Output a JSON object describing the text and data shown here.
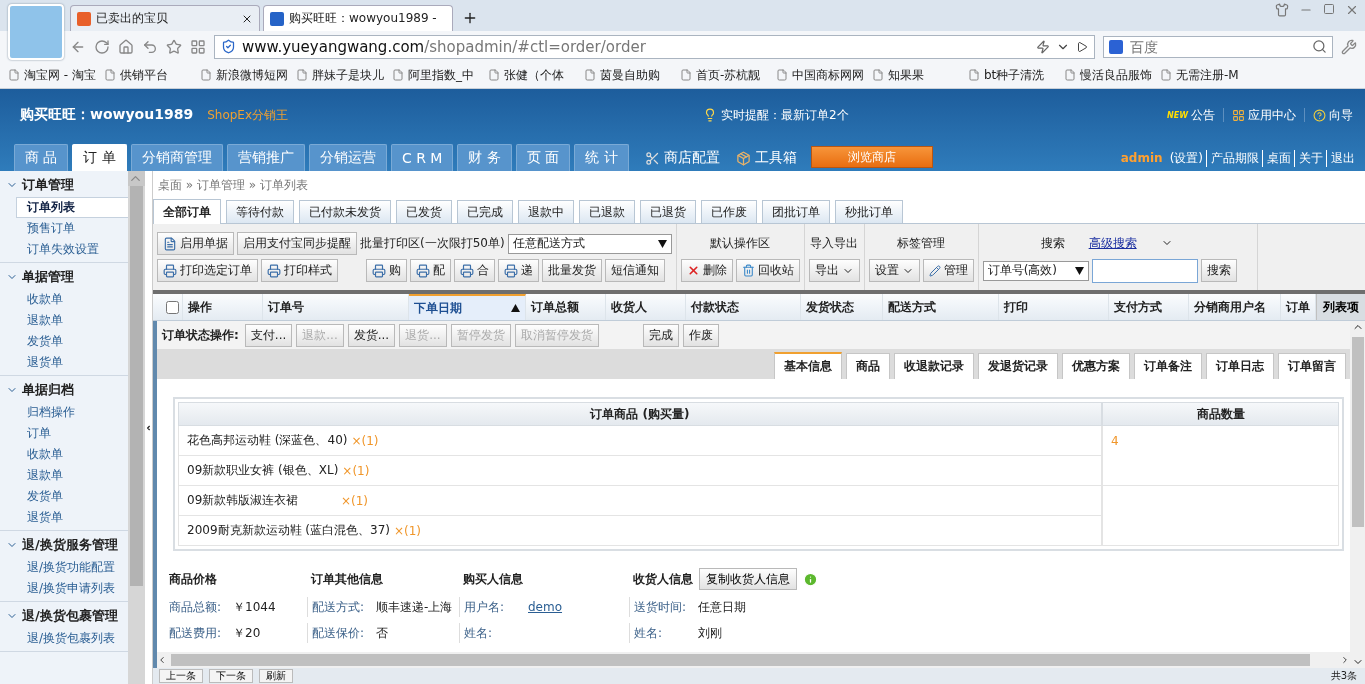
{
  "browser": {
    "tabs": [
      {
        "title": "已卖出的宝贝",
        "selected": false
      },
      {
        "title": "购买旺旺：wowyou1989 -",
        "selected": true
      }
    ],
    "url": {
      "host": "www.yueyangwang.com",
      "path": "/shopadmin/#ctl=order/order"
    },
    "search": {
      "placeholder": "百度"
    },
    "bookmarks": [
      "淘宝网 - 淘宝",
      "供销平台",
      "新浪微博短网",
      "胖妹子是块儿",
      "阿里指数_中",
      "张健（个体",
      "茵曼自助购",
      "首页-苏杭靓",
      "中国商标网网",
      "知果果",
      "bt种子清洗",
      "慢活良品服饰",
      "无需注册-M"
    ]
  },
  "header": {
    "title": "购买旺旺：wowyou1989",
    "brand": "ShopEx分销王",
    "notice": "实时提醒：最新订单2个",
    "new_badge": "NEW",
    "links": [
      "公告",
      "应用中心",
      "向导"
    ]
  },
  "nav": {
    "tabs": [
      {
        "label": "商 品",
        "selected": false
      },
      {
        "label": "订 单",
        "selected": true
      },
      {
        "label": "分销商管理",
        "selected": false
      },
      {
        "label": "营销推广",
        "selected": false
      },
      {
        "label": "分销运营",
        "selected": false
      },
      {
        "label": "C R M",
        "selected": false
      },
      {
        "label": "财 务",
        "selected": false
      },
      {
        "label": "页 面",
        "selected": false
      },
      {
        "label": "统 计",
        "selected": false
      }
    ],
    "tools": [
      "商店配置",
      "工具箱"
    ],
    "browse_button": "浏览商店",
    "user": "admin",
    "user_links": [
      "(设置)",
      "产品期限",
      "桌面",
      "关于",
      "退出"
    ]
  },
  "sidebar": [
    {
      "title": "订单管理",
      "expanded": true,
      "items": [
        {
          "label": "订单列表",
          "selected": true
        },
        {
          "label": "预售订单",
          "selected": false
        },
        {
          "label": "订单失效设置",
          "selected": false
        }
      ]
    },
    {
      "title": "单据管理",
      "expanded": true,
      "items": [
        {
          "label": "收款单",
          "selected": false
        },
        {
          "label": "退款单",
          "selected": false
        },
        {
          "label": "发货单",
          "selected": false
        },
        {
          "label": "退货单",
          "selected": false
        }
      ]
    },
    {
      "title": "单据归档",
      "expanded": true,
      "items": [
        {
          "label": "归档操作",
          "selected": false
        },
        {
          "label": "订单",
          "selected": false
        },
        {
          "label": "收款单",
          "selected": false
        },
        {
          "label": "退款单",
          "selected": false
        },
        {
          "label": "发货单",
          "selected": false
        },
        {
          "label": "退货单",
          "selected": false
        }
      ]
    },
    {
      "title": "退/换货服务管理",
      "expanded": true,
      "items": [
        {
          "label": "退/换货功能配置",
          "selected": false
        },
        {
          "label": "退/换货申请列表",
          "selected": false
        }
      ]
    },
    {
      "title": "退/换货包裹管理",
      "expanded": true,
      "items": [
        {
          "label": "退/换货包裹列表",
          "selected": false
        }
      ]
    }
  ],
  "breadcrumb": "桌面 » 订单管理 » 订单列表",
  "order_tabs": [
    {
      "label": "全部订单",
      "selected": true
    },
    {
      "label": "等待付款",
      "selected": false
    },
    {
      "label": "已付款未发货",
      "selected": false
    },
    {
      "label": "已发货",
      "selected": false
    },
    {
      "label": "已完成",
      "selected": false
    },
    {
      "label": "退款中",
      "selected": false
    },
    {
      "label": "已退款",
      "selected": false
    },
    {
      "label": "已退货",
      "selected": false
    },
    {
      "label": "已作废",
      "selected": false
    },
    {
      "label": "团批订单",
      "selected": false
    },
    {
      "label": "秒批订单",
      "selected": false
    }
  ],
  "toolbar": {
    "row1": [
      {
        "label": "启用单据"
      },
      {
        "label": "启用支付宝同步提醒"
      }
    ],
    "print_label": "批量打印区(一次限打50单)",
    "delivery_select": "任意配送方式",
    "row2": [
      {
        "label": "打印选定订单"
      },
      {
        "label": "打印样式"
      }
    ],
    "print_buttons": [
      {
        "label": "购"
      },
      {
        "label": "配"
      },
      {
        "label": "合"
      },
      {
        "label": "递"
      },
      {
        "label": "批量发货"
      },
      {
        "label": "短信通知"
      }
    ],
    "default_title": "默认操作区",
    "delete": "删除",
    "recycle": "回收站",
    "io_title": "导入导出",
    "export": "导出",
    "tag_title": "标签管理",
    "tag_set": "设置",
    "tag_manage": "管理",
    "search_title": "搜索",
    "advanced": "高级搜索",
    "search_field": "订单号(高效)",
    "search_button": "搜索"
  },
  "table": {
    "columns": [
      {
        "label": "操作",
        "sorted": false
      },
      {
        "label": "订单号",
        "sorted": false
      },
      {
        "label": "下单日期",
        "sorted": true
      },
      {
        "label": "订单总额",
        "sorted": false
      },
      {
        "label": "收货人",
        "sorted": false
      },
      {
        "label": "付款状态",
        "sorted": false
      },
      {
        "label": "发货状态",
        "sorted": false
      },
      {
        "label": "配送方式",
        "sorted": false
      },
      {
        "label": "打印",
        "sorted": false
      },
      {
        "label": "支付方式",
        "sorted": false
      },
      {
        "label": "分销商用户名",
        "sorted": false
      },
      {
        "label": "订单",
        "sorted": false
      }
    ],
    "column_button": "列表项",
    "select_all": false
  },
  "status_ops": {
    "label": "订单状态操作:",
    "buttons": [
      {
        "label": "支付...",
        "disabled": false
      },
      {
        "label": "退款...",
        "disabled": true
      },
      {
        "label": "发货...",
        "disabled": false
      },
      {
        "label": "退货...",
        "disabled": true
      },
      {
        "label": "暂停发货",
        "disabled": true
      },
      {
        "label": "取消暂停发货",
        "disabled": true
      }
    ],
    "final_buttons": [
      {
        "label": "完成",
        "disabled": false
      },
      {
        "label": "作废",
        "disabled": false
      }
    ]
  },
  "detail_tabs": [
    {
      "label": "基本信息",
      "selected": true
    },
    {
      "label": "商品",
      "selected": false
    },
    {
      "label": "收退款记录",
      "selected": false
    },
    {
      "label": "发退货记录",
      "selected": false
    },
    {
      "label": "优惠方案",
      "selected": false
    },
    {
      "label": "订单备注",
      "selected": false
    },
    {
      "label": "订单日志",
      "selected": false
    },
    {
      "label": "订单留言",
      "selected": false
    }
  ],
  "goods": {
    "columns": [
      "订单商品 (购买量)",
      "商品数量"
    ],
    "quantity": "4",
    "rows": [
      {
        "name": "花色高邦运动鞋 (深蓝色、40)",
        "count": "×(1)"
      },
      {
        "name": "09新款职业女裤 (银色、XL)",
        "count": "×(1)"
      },
      {
        "name": "09新款韩版淑连衣裙",
        "count": "×(1)"
      },
      {
        "name": "2009耐克新款运动鞋 (蓝白混色、37)",
        "count": "×(1)"
      }
    ]
  },
  "info": [
    {
      "title": "商品价格",
      "fields": [
        {
          "label": "商品总额:",
          "value": "￥1044",
          "kind": "text"
        },
        {
          "label": "配送费用:",
          "value": "￥20",
          "kind": "text"
        }
      ]
    },
    {
      "title": "订单其他信息",
      "fields": [
        {
          "label": "配送方式:",
          "value": "顺丰速递-上海",
          "kind": "text"
        },
        {
          "label": "配送保价:",
          "value": "否",
          "kind": "text"
        }
      ]
    },
    {
      "title": "购买人信息",
      "fields": [
        {
          "label": "用户名:",
          "value": "demo",
          "kind": "link"
        },
        {
          "label": "姓名:"
        }
      ]
    },
    {
      "title": "收货人信息",
      "button": "复制收货人信息",
      "fields": [
        {
          "label": "送货时间:",
          "value": "任意日期",
          "kind": "text"
        },
        {
          "label": "姓名:",
          "value": "刘刚",
          "kind": "text"
        }
      ]
    }
  ],
  "footer": {
    "buttons": [
      "上一条",
      "下一条",
      "刷新"
    ],
    "count": "共3条"
  }
}
